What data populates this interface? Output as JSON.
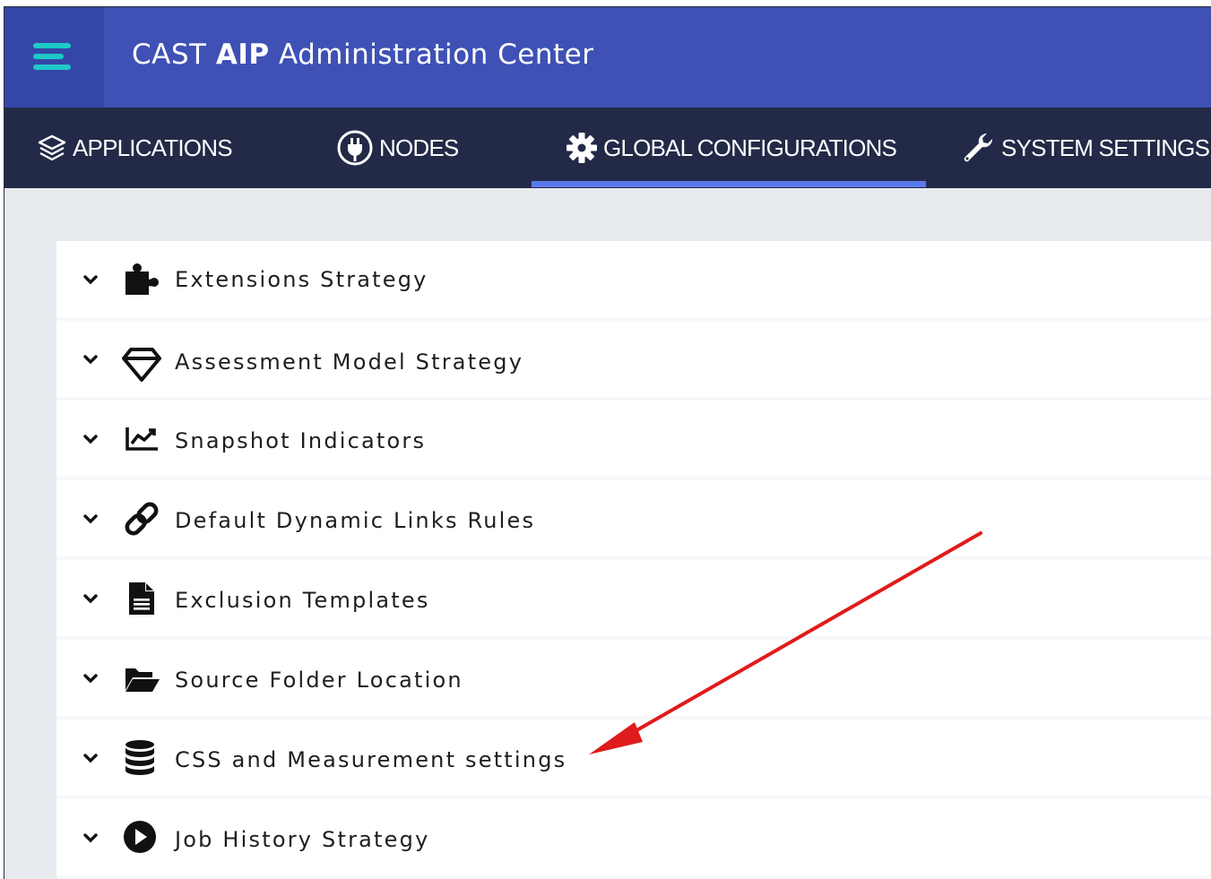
{
  "header": {
    "title_prefix": "CAST",
    "title_bold": "AIP",
    "title_suffix": "Administration Center",
    "menu_icon": "hamburger-menu-icon",
    "colors": {
      "header_bg": "#3f51b5",
      "menu_bg": "#3447a6",
      "menu_icon": "#1dc9c6",
      "nav_bg": "#232a47",
      "active_underline": "#5a78ee"
    }
  },
  "nav": {
    "tabs": [
      {
        "label": "APPLICATIONS",
        "icon": "layers-icon",
        "active": false
      },
      {
        "label": "NODES",
        "icon": "plug-icon",
        "active": false
      },
      {
        "label": "GLOBAL CONFIGURATIONS",
        "icon": "gear-icon",
        "active": true
      },
      {
        "label": "SYSTEM SETTINGS",
        "icon": "wrench-icon",
        "active": false
      }
    ]
  },
  "sections": {
    "items": [
      {
        "label": "Extensions Strategy",
        "icon": "puzzle-piece-icon"
      },
      {
        "label": "Assessment Model Strategy",
        "icon": "diamond-icon"
      },
      {
        "label": "Snapshot Indicators",
        "icon": "line-chart-icon"
      },
      {
        "label": "Default Dynamic Links Rules",
        "icon": "link-icon"
      },
      {
        "label": "Exclusion Templates",
        "icon": "file-text-icon"
      },
      {
        "label": "Source Folder Location",
        "icon": "folder-open-icon"
      },
      {
        "label": "CSS and Measurement settings",
        "icon": "database-icon"
      },
      {
        "label": "Job History Strategy",
        "icon": "play-circle-icon"
      }
    ],
    "expand_icon": "chevron-down-icon"
  },
  "annotation": {
    "type": "arrow",
    "color": "#e01b1b",
    "target": "CSS and Measurement settings"
  }
}
